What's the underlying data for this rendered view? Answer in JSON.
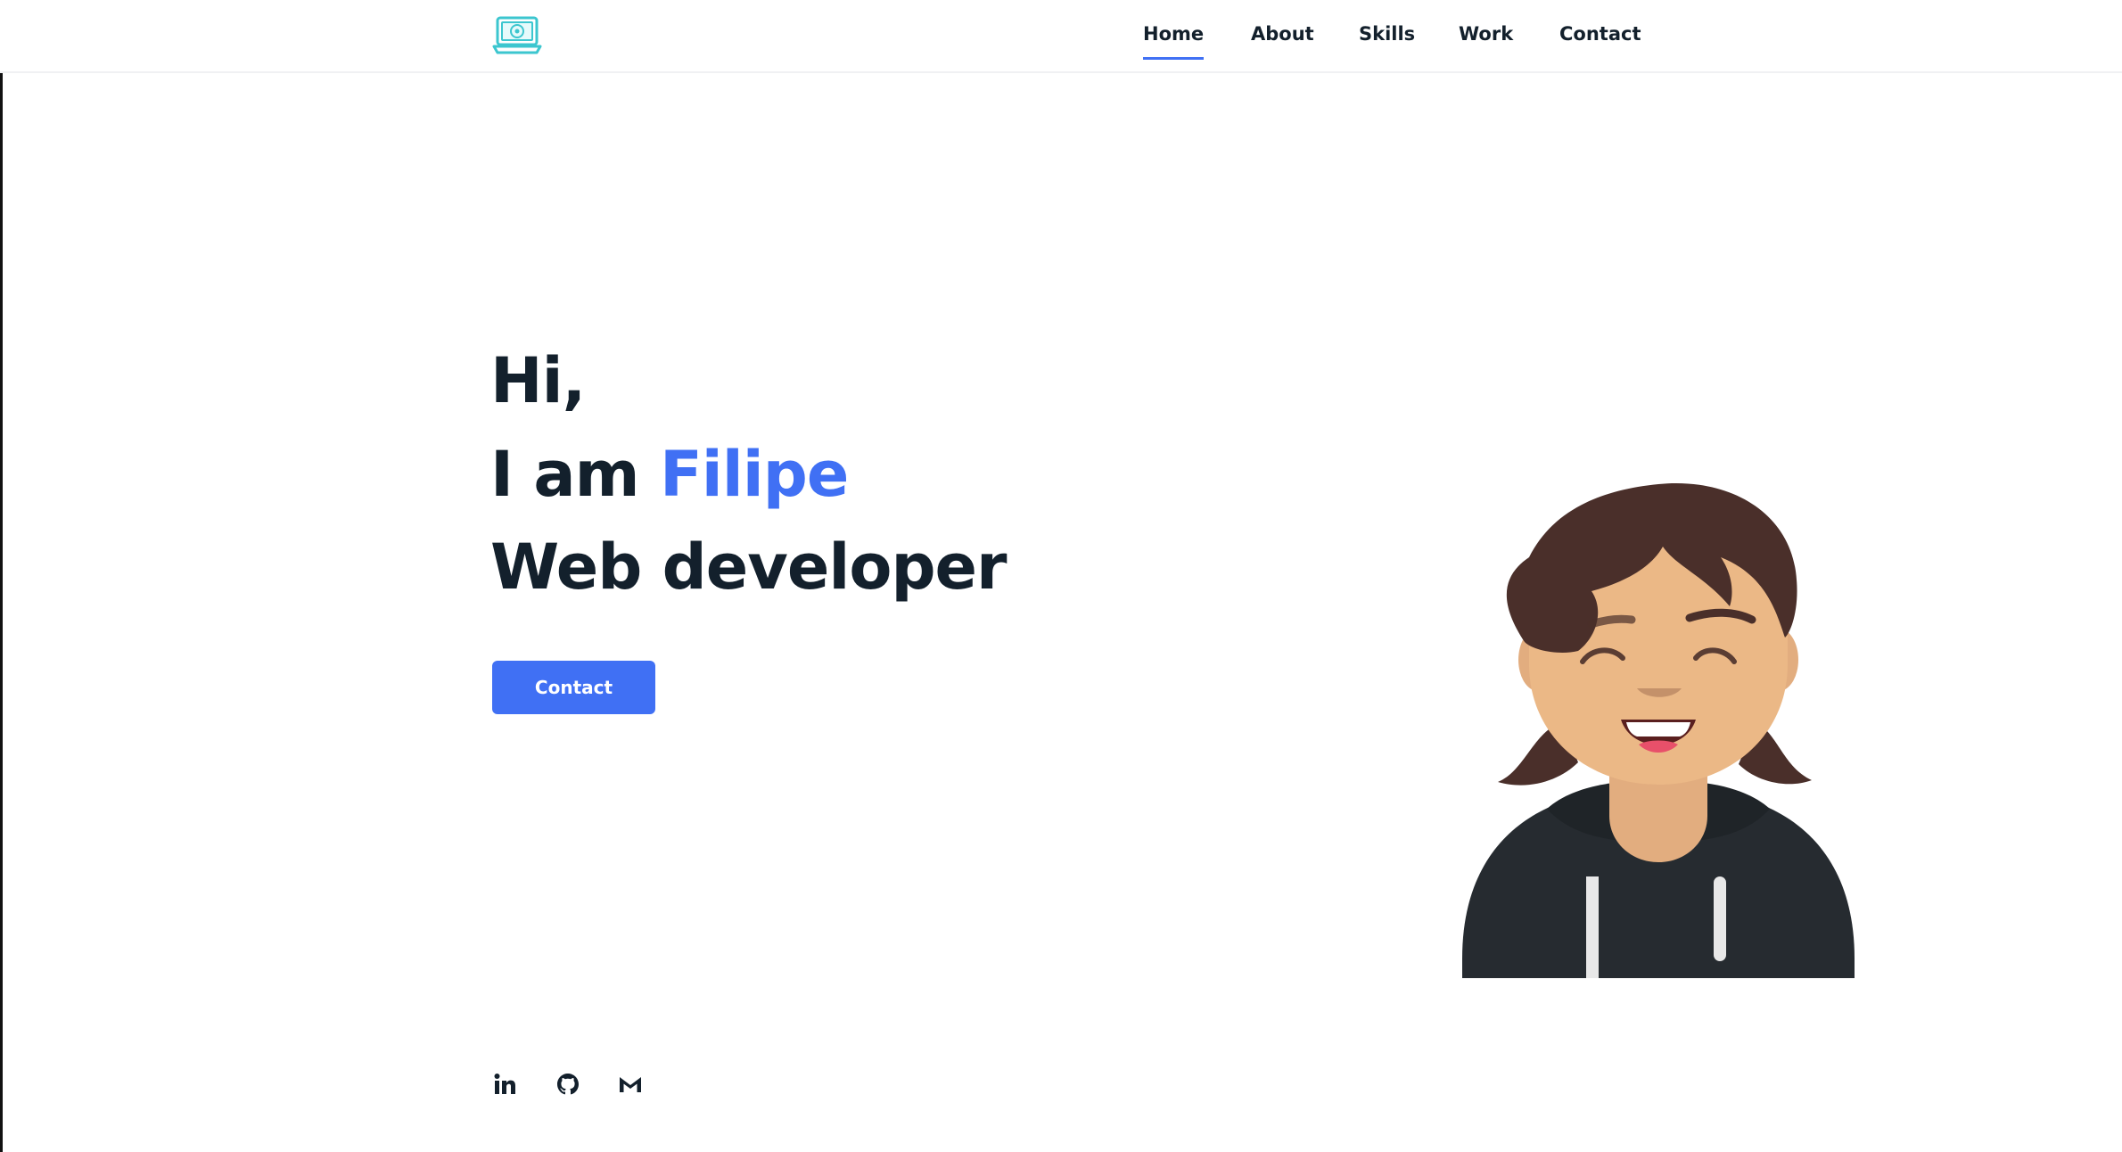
{
  "nav": {
    "items": [
      {
        "label": "Home",
        "active": true
      },
      {
        "label": "About",
        "active": false
      },
      {
        "label": "Skills",
        "active": false
      },
      {
        "label": "Work",
        "active": false
      },
      {
        "label": "Contact",
        "active": false
      }
    ]
  },
  "hero": {
    "greeting": "Hi,",
    "intro_prefix": "I am",
    "name": "Filipe",
    "role": "Web developer",
    "cta_label": "Contact"
  },
  "social": [
    {
      "icon": "linkedin-icon"
    },
    {
      "icon": "github-icon"
    },
    {
      "icon": "gmail-icon"
    }
  ],
  "colors": {
    "accent": "#4070f4",
    "text": "#13202c",
    "logo": "#3cc6cf"
  }
}
